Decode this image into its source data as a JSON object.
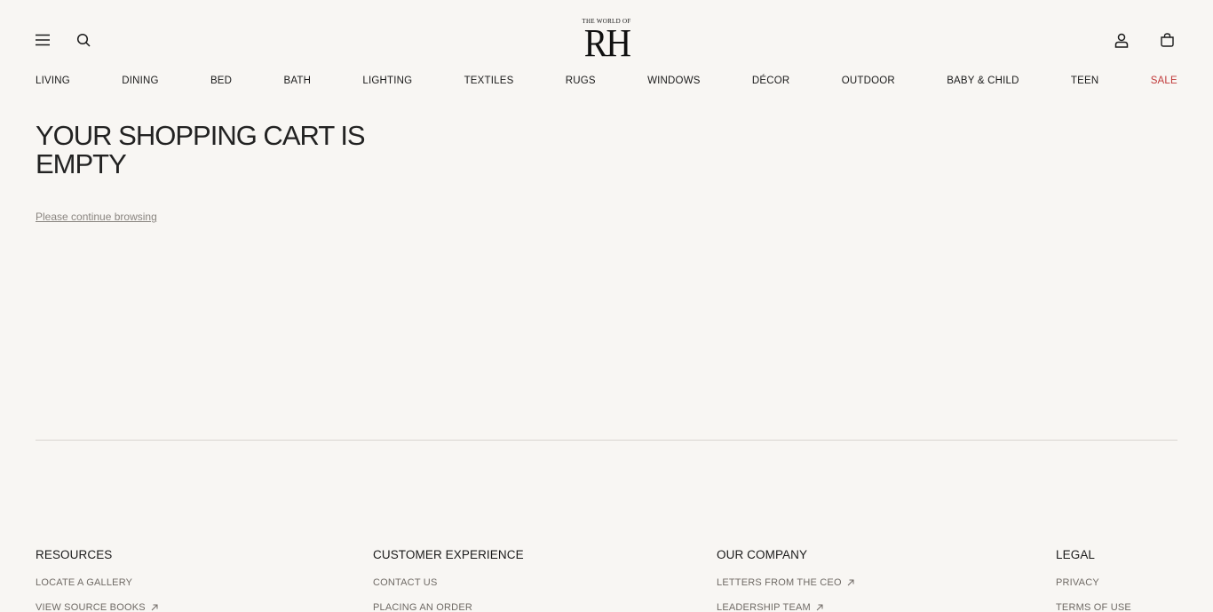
{
  "header": {
    "logo_sub": "THE WORLD OF",
    "logo_main": "RH"
  },
  "nav": [
    "LIVING",
    "DINING",
    "BED",
    "BATH",
    "LIGHTING",
    "TEXTILES",
    "RUGS",
    "WINDOWS",
    "DÉCOR",
    "OUTDOOR",
    "BABY & CHILD",
    "TEEN",
    "SALE"
  ],
  "main": {
    "title": "YOUR SHOPPING CART IS EMPTY",
    "continue_link": "Please continue browsing"
  },
  "colors": {
    "background": "#f8f6f3",
    "sale": "#c03a3a",
    "link": "#8a8580"
  },
  "footer": {
    "resources": {
      "heading": "RESOURCES",
      "links": [
        "LOCATE A GALLERY",
        "VIEW SOURCE BOOKS"
      ]
    },
    "customer_experience": {
      "heading": "CUSTOMER EXPERIENCE",
      "links": [
        "CONTACT US",
        "PLACING AN ORDER"
      ]
    },
    "our_company": {
      "heading": "OUR COMPANY",
      "links": [
        "LETTERS FROM THE CEO",
        "LEADERSHIP TEAM"
      ]
    },
    "legal": {
      "heading": "LEGAL",
      "links": [
        "PRIVACY",
        "TERMS OF USE"
      ]
    }
  }
}
